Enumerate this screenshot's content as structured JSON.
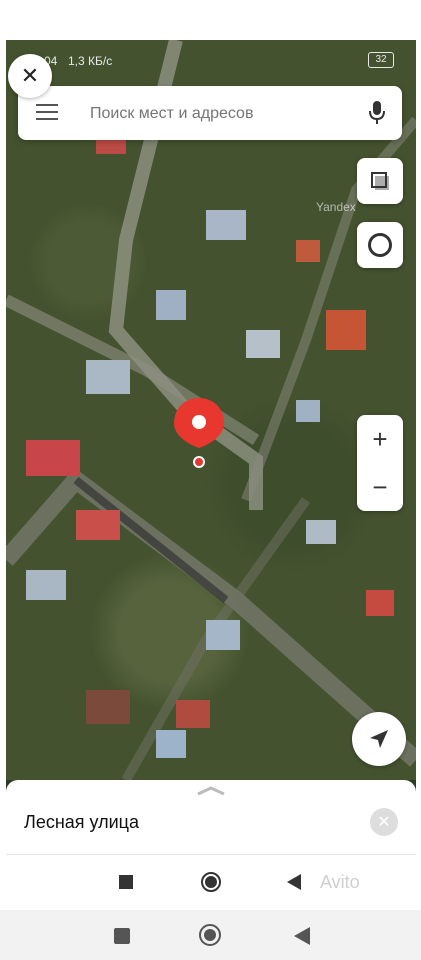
{
  "status_bar": {
    "time_fragment": "04",
    "network_speed": "1,3 КБ/с",
    "battery": "32"
  },
  "search": {
    "placeholder": "Поиск мест и адресов"
  },
  "map": {
    "watermark": "Yandex",
    "controls": {
      "zoom_in": "+",
      "zoom_out": "−"
    }
  },
  "close_button": {
    "glyph": "✕"
  },
  "place": {
    "title": "Лесная улица",
    "close_glyph": "✕"
  },
  "overlay": {
    "brand": "Avito"
  },
  "icons": {
    "menu": "hamburger-menu-icon",
    "mic": "microphone-icon",
    "layers": "layers-icon",
    "traffic": "traffic-icon",
    "locate": "navigation-arrow-icon",
    "pin": "map-pin-icon"
  },
  "colors": {
    "pin": "#e8372f",
    "map_dark": "#2f3b26"
  }
}
